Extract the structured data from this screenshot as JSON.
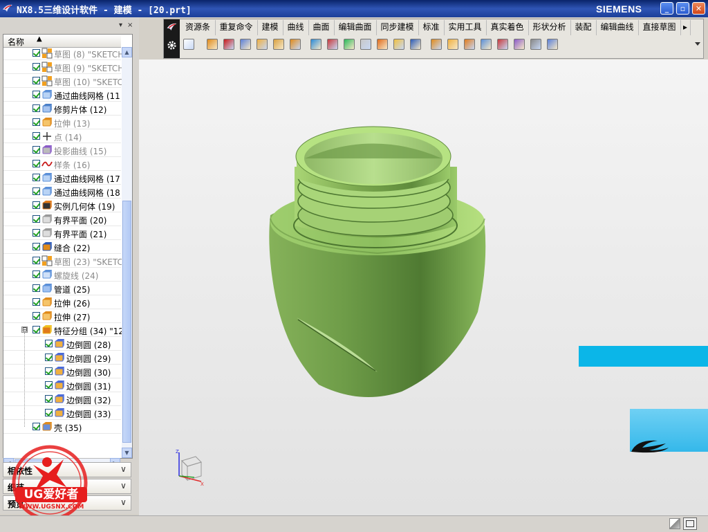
{
  "window": {
    "title": "NX8.5三维设计软件 - 建模 - [20.prt]",
    "brand": "SIEMENS",
    "min_label": "_",
    "max_label": "▫",
    "close_label": "✕"
  },
  "navigator": {
    "column_header": "名称",
    "sort_indicator": "▲",
    "rows": [
      {
        "label": "草图 (8) \"SKETCH",
        "icon": "sketch-icon",
        "active": false
      },
      {
        "label": "草图 (9) \"SKETCH",
        "icon": "sketch-icon",
        "active": false
      },
      {
        "label": "草图 (10) \"SKETC",
        "icon": "sketch-icon",
        "active": false
      },
      {
        "label": "通过曲线网格 (11",
        "icon": "through-curve-mesh-icon",
        "active": true
      },
      {
        "label": "修剪片体 (12)",
        "icon": "trim-sheet-icon",
        "active": true
      },
      {
        "label": "拉伸 (13)",
        "icon": "extrude-icon",
        "active": false
      },
      {
        "label": "点 (14)",
        "icon": "point-icon",
        "active": false
      },
      {
        "label": "投影曲线 (15)",
        "icon": "project-curve-icon",
        "active": false
      },
      {
        "label": "样条 (16)",
        "icon": "spline-icon",
        "active": false
      },
      {
        "label": "通过曲线网格 (17",
        "icon": "through-curve-mesh-icon",
        "active": true
      },
      {
        "label": "通过曲线网格 (18",
        "icon": "through-curve-mesh-icon",
        "active": true
      },
      {
        "label": "实例几何体 (19)",
        "icon": "instance-geometry-icon",
        "active": true
      },
      {
        "label": "有界平面 (20)",
        "icon": "bounded-plane-icon",
        "active": true
      },
      {
        "label": "有界平面 (21)",
        "icon": "bounded-plane-icon",
        "active": true
      },
      {
        "label": "缝合 (22)",
        "icon": "sew-icon",
        "active": true
      },
      {
        "label": "草图 (23) \"SKETC",
        "icon": "sketch-icon",
        "active": false
      },
      {
        "label": "螺旋线 (24)",
        "icon": "helix-icon",
        "active": false
      },
      {
        "label": "管道 (25)",
        "icon": "tube-icon",
        "active": true
      },
      {
        "label": "拉伸 (26)",
        "icon": "extrude-icon",
        "active": true
      },
      {
        "label": "拉伸 (27)",
        "icon": "extrude-icon",
        "active": true
      },
      {
        "label": "特征分组 (34) \"12",
        "icon": "feature-group-icon",
        "active": true
      },
      {
        "label": "边倒圆 (28)",
        "icon": "edge-blend-icon",
        "active": true
      },
      {
        "label": "边倒圆 (29)",
        "icon": "edge-blend-icon",
        "active": true
      },
      {
        "label": "边倒圆 (30)",
        "icon": "edge-blend-icon",
        "active": true
      },
      {
        "label": "边倒圆 (31)",
        "icon": "edge-blend-icon",
        "active": true
      },
      {
        "label": "边倒圆 (32)",
        "icon": "edge-blend-icon",
        "active": true
      },
      {
        "label": "边倒圆 (33)",
        "icon": "edge-blend-icon",
        "active": true
      },
      {
        "label": "壳 (35)",
        "icon": "shell-icon",
        "active": true
      }
    ],
    "group_toggle": "⊟",
    "panels": [
      {
        "label": "相依性"
      },
      {
        "label": "细节"
      },
      {
        "label": "预览"
      }
    ]
  },
  "toolbar": {
    "menus": [
      "资源条",
      "重复命令",
      "建模",
      "曲线",
      "曲面",
      "编辑曲面",
      "同步建模",
      "标准",
      "实用工具",
      "真实着色",
      "形状分析",
      "装配",
      "编辑曲线",
      "直接草图"
    ],
    "more_label": "▸"
  },
  "watermark": {
    "text": "UG爱好者",
    "url": "WWW.UGSNX.COM"
  },
  "colors": {
    "model_green": "#8ebd5c",
    "title_blue": "#0a246a",
    "active_text": "#000000",
    "inactive_text": "#8a8a8a"
  }
}
